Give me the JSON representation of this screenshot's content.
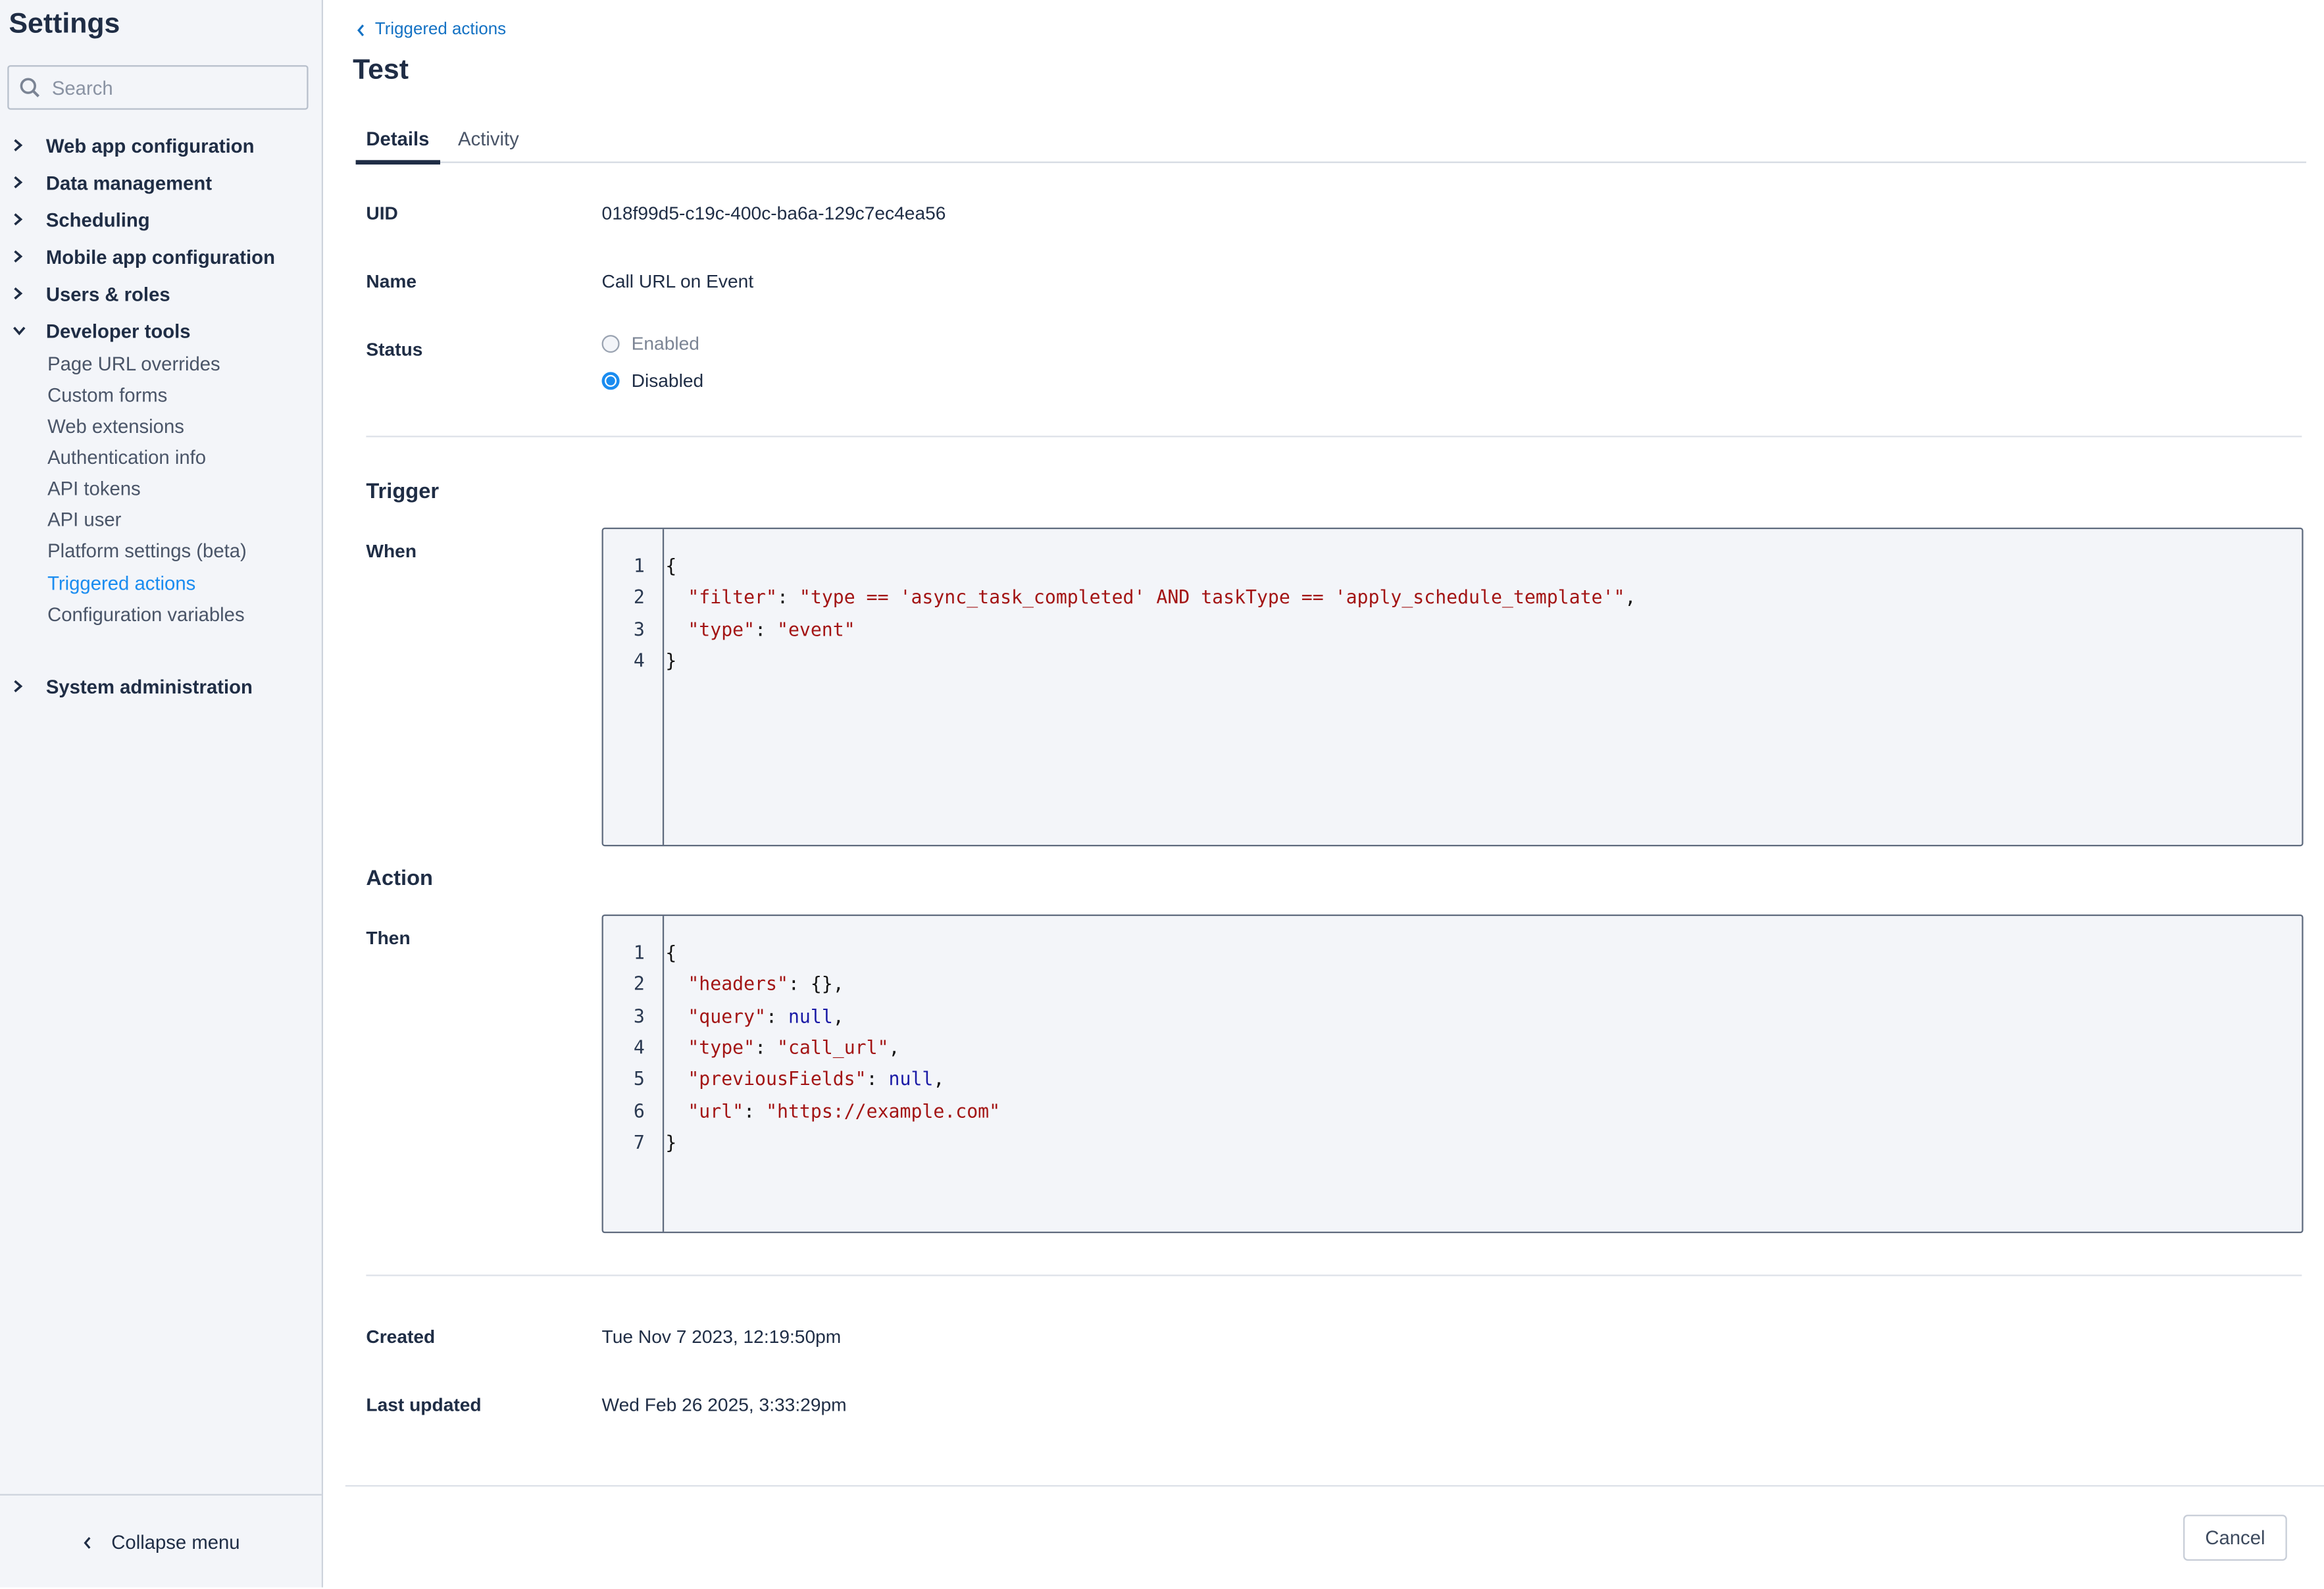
{
  "sidebar": {
    "title": "Settings",
    "search_placeholder": "Search",
    "search_value": "",
    "groups": [
      {
        "label": "Web app configuration",
        "expanded": false
      },
      {
        "label": "Data management",
        "expanded": false
      },
      {
        "label": "Scheduling",
        "expanded": false
      },
      {
        "label": "Mobile app configuration",
        "expanded": false
      },
      {
        "label": "Users & roles",
        "expanded": false
      },
      {
        "label": "Developer tools",
        "expanded": true
      },
      {
        "label": "System administration",
        "expanded": false
      }
    ],
    "developer_tools_items": [
      {
        "label": "Page URL overrides",
        "active": false
      },
      {
        "label": "Custom forms",
        "active": false
      },
      {
        "label": "Web extensions",
        "active": false
      },
      {
        "label": "Authentication info",
        "active": false
      },
      {
        "label": "API tokens",
        "active": false
      },
      {
        "label": "API user",
        "active": false
      },
      {
        "label": "Platform settings (beta)",
        "active": false
      },
      {
        "label": "Triggered actions",
        "active": true
      },
      {
        "label": "Configuration variables",
        "active": false
      }
    ],
    "collapse_label": "Collapse menu"
  },
  "header": {
    "breadcrumb": "Triggered actions",
    "title": "Test"
  },
  "tabs": [
    {
      "label": "Details",
      "active": true
    },
    {
      "label": "Activity",
      "active": false
    }
  ],
  "details": {
    "uid_label": "UID",
    "uid_value": "018f99d5-c19c-400c-ba6a-129c7ec4ea56",
    "name_label": "Name",
    "name_value": "Call URL on Event",
    "status_label": "Status",
    "status_options": [
      {
        "label": "Enabled",
        "selected": false
      },
      {
        "label": "Disabled",
        "selected": true
      }
    ]
  },
  "trigger": {
    "heading": "Trigger",
    "when_label": "When",
    "code_lines": [
      [
        {
          "t": "p",
          "v": "{"
        }
      ],
      [
        {
          "t": "p",
          "v": "  "
        },
        {
          "t": "str",
          "v": "\"filter\""
        },
        {
          "t": "p",
          "v": ": "
        },
        {
          "t": "str",
          "v": "\"type == 'async_task_completed' AND taskType == 'apply_schedule_template'\""
        },
        {
          "t": "p",
          "v": ","
        }
      ],
      [
        {
          "t": "p",
          "v": "  "
        },
        {
          "t": "str",
          "v": "\"type\""
        },
        {
          "t": "p",
          "v": ": "
        },
        {
          "t": "str",
          "v": "\"event\""
        }
      ],
      [
        {
          "t": "p",
          "v": "}"
        }
      ]
    ]
  },
  "action": {
    "heading": "Action",
    "then_label": "Then",
    "code_lines": [
      [
        {
          "t": "p",
          "v": "{"
        }
      ],
      [
        {
          "t": "p",
          "v": "  "
        },
        {
          "t": "str",
          "v": "\"headers\""
        },
        {
          "t": "p",
          "v": ": {},"
        }
      ],
      [
        {
          "t": "p",
          "v": "  "
        },
        {
          "t": "str",
          "v": "\"query\""
        },
        {
          "t": "p",
          "v": ": "
        },
        {
          "t": "null",
          "v": "null"
        },
        {
          "t": "p",
          "v": ","
        }
      ],
      [
        {
          "t": "p",
          "v": "  "
        },
        {
          "t": "str",
          "v": "\"type\""
        },
        {
          "t": "p",
          "v": ": "
        },
        {
          "t": "str",
          "v": "\"call_url\""
        },
        {
          "t": "p",
          "v": ","
        }
      ],
      [
        {
          "t": "p",
          "v": "  "
        },
        {
          "t": "str",
          "v": "\"previousFields\""
        },
        {
          "t": "p",
          "v": ": "
        },
        {
          "t": "null",
          "v": "null"
        },
        {
          "t": "p",
          "v": ","
        }
      ],
      [
        {
          "t": "p",
          "v": "  "
        },
        {
          "t": "str",
          "v": "\"url\""
        },
        {
          "t": "p",
          "v": ": "
        },
        {
          "t": "str",
          "v": "\"https://example.com\""
        }
      ],
      [
        {
          "t": "p",
          "v": "}"
        }
      ]
    ]
  },
  "meta": {
    "created_label": "Created",
    "created_value": "Tue Nov 7 2023, 12:19:50pm",
    "updated_label": "Last updated",
    "updated_value": "Wed Feb 26 2025, 3:33:29pm"
  },
  "footer": {
    "cancel_label": "Cancel"
  },
  "colors": {
    "accent": "#1a8cf0",
    "link": "#1472c4",
    "text": "#1f2d45",
    "sidebar_bg": "#f3f5f9",
    "code_string": "#a31515",
    "code_null": "#1a1aa6"
  }
}
